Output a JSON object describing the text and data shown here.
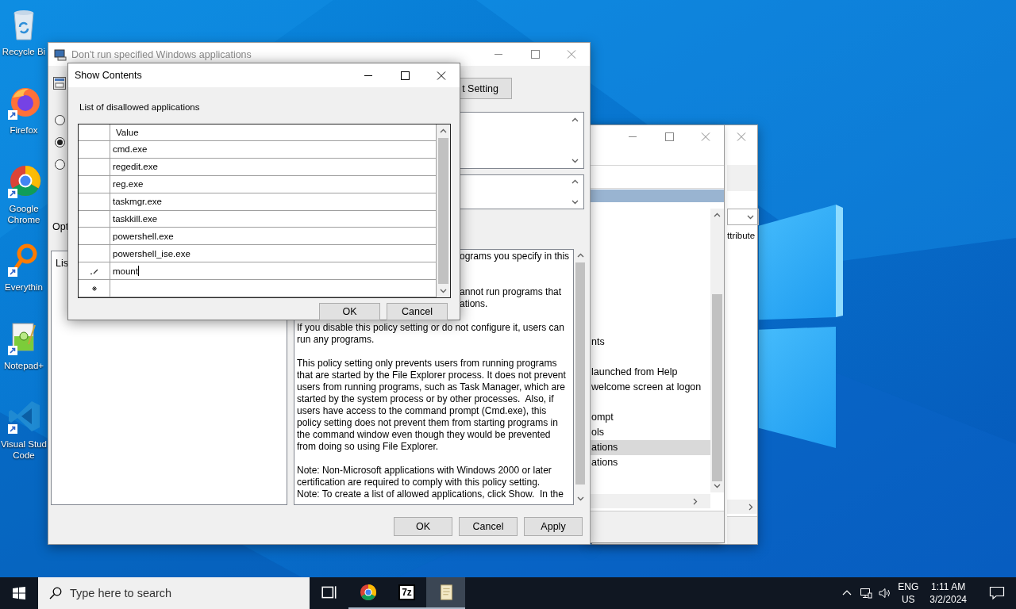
{
  "desktop_icons": [
    {
      "kind": "recycle-bin",
      "label": "Recycle Bi"
    },
    {
      "kind": "firefox",
      "label": "Firefox"
    },
    {
      "kind": "chrome",
      "label": "Google Chrome"
    },
    {
      "kind": "everything",
      "label": "Everythin"
    },
    {
      "kind": "notepad",
      "label": "Notepad+"
    },
    {
      "kind": "vscode",
      "label": "Visual Stud Code"
    }
  ],
  "back_window_2": {
    "column_text": "ttribute"
  },
  "back_window_1": {
    "items": [
      {
        "label": "nts",
        "selected": false
      },
      {
        "label": "launched from Help",
        "selected": false
      },
      {
        "label": "welcome screen at logon",
        "selected": false
      },
      {
        "label": "ompt",
        "selected": false
      },
      {
        "label": "ols",
        "selected": false
      },
      {
        "label": "ations",
        "selected": true
      },
      {
        "label": "ations",
        "selected": false
      }
    ]
  },
  "policy_window": {
    "title": "Don't run specified Windows applications",
    "radios": [
      {
        "selected": false
      },
      {
        "selected": true
      },
      {
        "selected": false
      }
    ],
    "options_label": "Opt",
    "list_label": "Lis",
    "setting_button": "t Setting",
    "help_fragments": [
      "ograms you specify in this",
      "annot run programs that",
      "ations."
    ],
    "help_paragraphs": [
      "If you disable this policy setting or do not configure it, users can run any programs.",
      "This policy setting only prevents users from running programs that are started by the File Explorer process. It does not prevent users from running programs, such as Task Manager, which are started by the system process or by other processes.  Also, if users have access to the command prompt (Cmd.exe), this policy setting does not prevent them from starting programs in the command window even though they would be prevented from doing so using File Explorer.",
      "Note: Non-Microsoft applications with Windows 2000 or later certification are required to comply with this policy setting.\nNote: To create a list of allowed applications, click Show.  In the"
    ],
    "buttons": [
      "OK",
      "Cancel",
      "Apply"
    ]
  },
  "dialog": {
    "title": "Show Contents",
    "label": "List of disallowed applications",
    "column": "Value",
    "rows": [
      {
        "kind": "normal",
        "value": "cmd.exe"
      },
      {
        "kind": "normal",
        "value": "regedit.exe"
      },
      {
        "kind": "normal",
        "value": "reg.exe"
      },
      {
        "kind": "normal",
        "value": "taskmgr.exe"
      },
      {
        "kind": "normal",
        "value": "taskkill.exe"
      },
      {
        "kind": "normal",
        "value": "powershell.exe"
      },
      {
        "kind": "normal",
        "value": "powershell_ise.exe"
      },
      {
        "kind": "editing",
        "value": "mount"
      },
      {
        "kind": "new"
      }
    ],
    "buttons": [
      "OK",
      "Cancel"
    ]
  },
  "taskbar": {
    "search": {
      "placeholder": "Type here to search"
    },
    "apps": [
      {
        "kind": "task-view",
        "running": false,
        "active": false
      },
      {
        "kind": "chrome",
        "running": true,
        "active": false
      },
      {
        "kind": "archiver",
        "label": "7z",
        "running": true,
        "active": false
      },
      {
        "kind": "notes",
        "running": true,
        "active": true
      }
    ],
    "language": "ENG",
    "region": "US",
    "time": "1:11 AM",
    "date": "3/2/2024"
  }
}
